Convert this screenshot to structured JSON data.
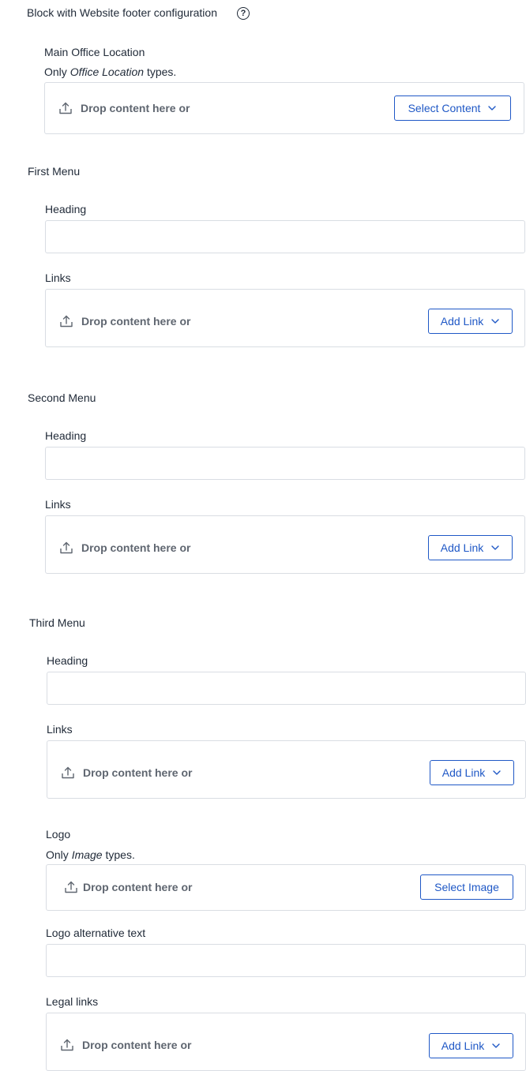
{
  "block_title": "Block with Website footer configuration",
  "main_office": {
    "label": "Main Office Location",
    "hint_prefix": "Only ",
    "hint_type": "Office Location",
    "hint_suffix": " types.",
    "drop_text": "Drop content here or",
    "button": "Select Content"
  },
  "first_menu": {
    "title": "First Menu",
    "heading_label": "Heading",
    "heading_value": "",
    "links_label": "Links",
    "drop_text": "Drop content here or",
    "button": "Add Link"
  },
  "second_menu": {
    "title": "Second Menu",
    "heading_label": "Heading",
    "heading_value": "",
    "links_label": "Links",
    "drop_text": "Drop content here or",
    "button": "Add Link"
  },
  "third_menu": {
    "title": "Third Menu",
    "heading_label": "Heading",
    "heading_value": "",
    "links_label": "Links",
    "drop_text": "Drop content here or",
    "button": "Add Link"
  },
  "logo": {
    "label": "Logo",
    "hint_prefix": "Only ",
    "hint_type": "Image",
    "hint_suffix": " types.",
    "drop_text": "Drop content here or",
    "button": "Select Image"
  },
  "logo_alt": {
    "label": "Logo alternative text",
    "value": ""
  },
  "legal_links": {
    "label": "Legal links",
    "drop_text": "Drop content here or",
    "button": "Add Link"
  },
  "colors": {
    "accent": "#1f58c6",
    "border": "#d9dde3",
    "muted_text": "#5f6670"
  },
  "icons": [
    "help-icon",
    "upload-icon",
    "chevron-down-icon"
  ]
}
